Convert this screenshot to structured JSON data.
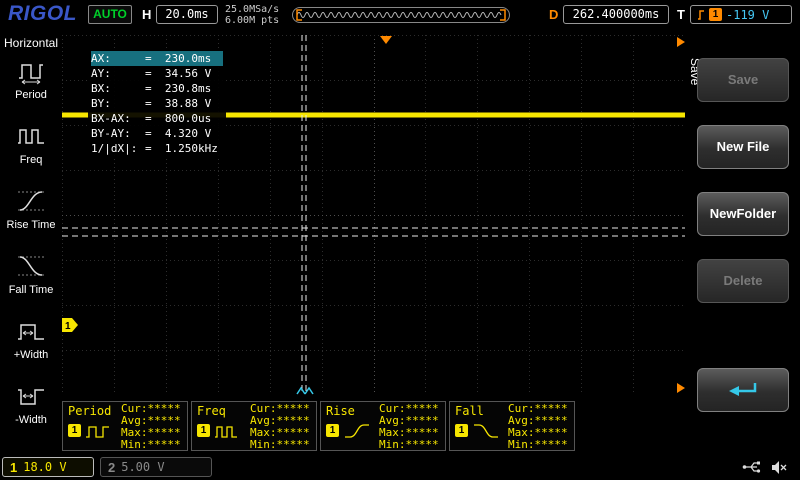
{
  "top_bar": {
    "logo": "RIGOL",
    "mode": "AUTO",
    "horizontal_label": "H",
    "timebase": "20.0ms",
    "sample_rate": "25.0MSa/s",
    "memory_depth": "6.00M pts",
    "delay_label": "D",
    "delay_value": "262.400000ms",
    "trigger_label": "T",
    "trigger_source": "1",
    "trigger_level": "-119 V"
  },
  "sidebar": {
    "title": "Horizontal",
    "items": [
      {
        "label": "Period"
      },
      {
        "label": "Freq"
      },
      {
        "label": "Rise Time"
      },
      {
        "label": "Fall Time"
      },
      {
        "label": "+Width"
      },
      {
        "label": "-Width"
      }
    ]
  },
  "grid": {
    "ch1_marker": "1"
  },
  "cursor_info": {
    "rows": [
      {
        "label": "AX:",
        "value": "=  230.0ms"
      },
      {
        "label": "AY:",
        "value": "=  34.56 V"
      },
      {
        "label": "BX:",
        "value": "=  230.8ms"
      },
      {
        "label": "BY:",
        "value": "=  38.88 V"
      },
      {
        "label": "BX-AX:",
        "value": "=  800.0us"
      },
      {
        "label": "BY-AY:",
        "value": "=  4.320 V"
      },
      {
        "label": "1/|dX|:",
        "value": "=  1.250kHz"
      }
    ]
  },
  "measurements": [
    {
      "name": "Period",
      "channel": "1",
      "cur": "Cur:*****",
      "avg": "Avg:*****",
      "max": "Max:*****",
      "min": "Min:*****"
    },
    {
      "name": "Freq",
      "channel": "1",
      "cur": "Cur:*****",
      "avg": "Avg:*****",
      "max": "Max:*****",
      "min": "Min:*****"
    },
    {
      "name": "Rise",
      "channel": "1",
      "cur": "Cur:*****",
      "avg": "Avg:*****",
      "max": "Max:*****",
      "min": "Min:*****"
    },
    {
      "name": "Fall",
      "channel": "1",
      "cur": "Cur:*****",
      "avg": "Avg:*****",
      "max": "Max:*****",
      "min": "Min:*****"
    }
  ],
  "channels": {
    "ch1": {
      "label": "1",
      "scale": "18.0 V"
    },
    "ch2": {
      "label": "2",
      "scale": "5.00 V"
    }
  },
  "menu": {
    "tab": "Save",
    "buttons": [
      {
        "label": "Save",
        "enabled": false
      },
      {
        "label": "New File",
        "enabled": true
      },
      {
        "label": "NewFolder",
        "enabled": true
      },
      {
        "label": "Delete",
        "enabled": false
      }
    ]
  },
  "icons": {
    "enter": "return-arrow",
    "usb": "usb-plug",
    "speaker": "speaker-muted",
    "memory": "waveform-memory"
  },
  "colors": {
    "ch1": "#f7e600",
    "ch2": "#8a8a8a",
    "trigger": "#ff8a00",
    "cursor_highlight": "#17707f",
    "auto_green": "#00d02a",
    "logo_blue": "#3a57c8",
    "trigger_level_blue": "#45c8f5"
  }
}
